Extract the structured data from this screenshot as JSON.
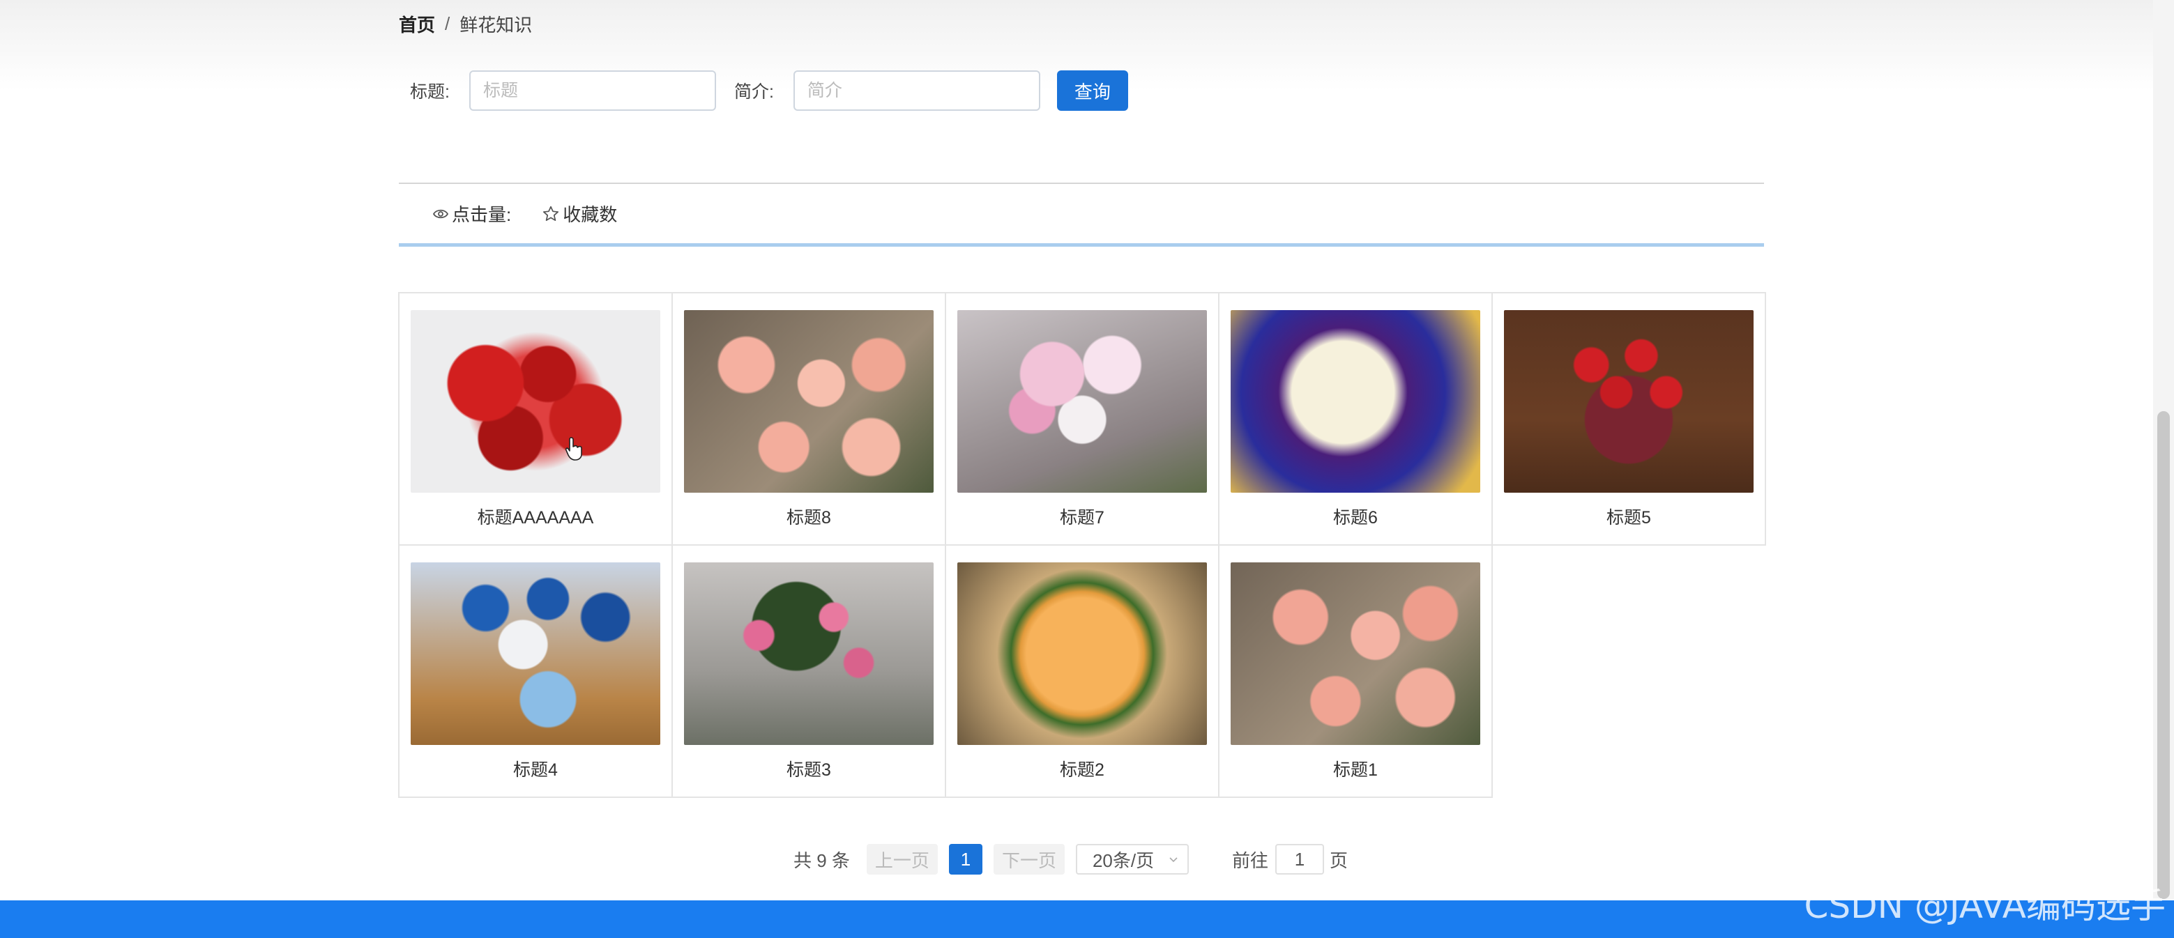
{
  "breadcrumb": {
    "home": "首页",
    "separator": "/",
    "current": "鲜花知识"
  },
  "search": {
    "title_label": "标题:",
    "title_placeholder": "标题",
    "title_value": "",
    "intro_label": "简介:",
    "intro_placeholder": "简介",
    "intro_value": "",
    "query_button": "查询"
  },
  "sort": {
    "clicks_label": "点击量:",
    "clicks_icon": "eye-icon",
    "favorites_label": "收藏数",
    "favorites_icon": "star-icon"
  },
  "cards": [
    {
      "title": "标题AAAAAAA",
      "image": "flower-photo"
    },
    {
      "title": "标题8",
      "image": "flower-photo"
    },
    {
      "title": "标题7",
      "image": "flower-photo"
    },
    {
      "title": "标题6",
      "image": "flower-photo"
    },
    {
      "title": "标题5",
      "image": "flower-photo"
    },
    {
      "title": "标题4",
      "image": "flower-photo"
    },
    {
      "title": "标题3",
      "image": "flower-photo"
    },
    {
      "title": "标题2",
      "image": "flower-photo"
    },
    {
      "title": "标题1",
      "image": "flower-photo"
    }
  ],
  "pagination": {
    "total": "共 9 条",
    "prev": "上一页",
    "current_page": "1",
    "next": "下一页",
    "page_size": "20条/页",
    "goto_prefix": "前往",
    "goto_value": "1",
    "goto_suffix": "页"
  },
  "watermark": "CSDN @JAVA编码选手",
  "colors": {
    "primary": "#1a73d9",
    "footer": "#1a7df0",
    "sort_underline": "#a9cdee"
  }
}
